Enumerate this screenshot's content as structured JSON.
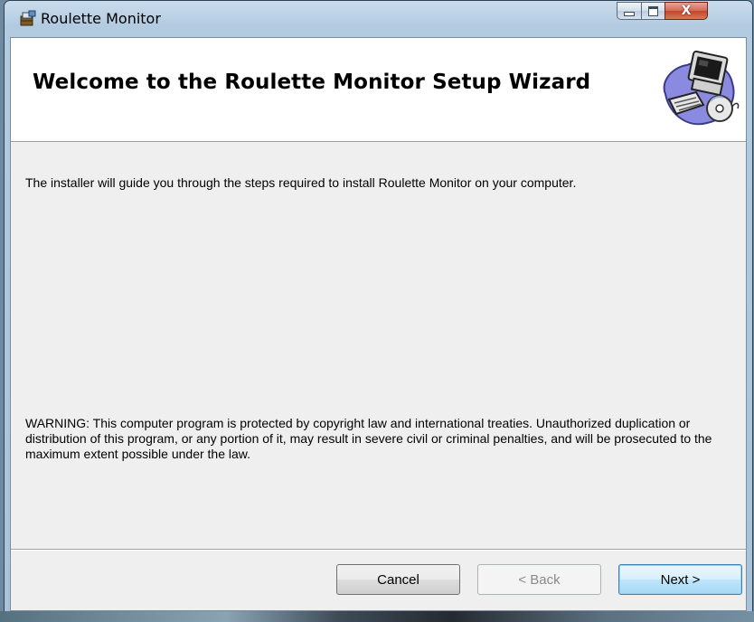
{
  "window": {
    "title": "Roulette Monitor",
    "controls": {
      "minimize": "minimize",
      "maximize": "maximize",
      "close_glyph": "X"
    }
  },
  "banner": {
    "title": "Welcome to the Roulette Monitor Setup Wizard",
    "art_icon": "computer-setup-icon"
  },
  "body": {
    "intro": "The installer will guide you through the steps required to install Roulette Monitor on your computer.",
    "warning": "WARNING: This computer program is protected by copyright law and international treaties. Unauthorized duplication or distribution of this program, or any portion of it, may result in severe civil or criminal penalties, and will be prosecuted to the maximum extent possible under the law."
  },
  "buttons": {
    "cancel": "Cancel",
    "back": "< Back",
    "back_enabled": false,
    "next": "Next >"
  },
  "colors": {
    "title_bar": "#b3cbe1",
    "close_button": "#c4452b",
    "next_button": "#bee6fd"
  }
}
